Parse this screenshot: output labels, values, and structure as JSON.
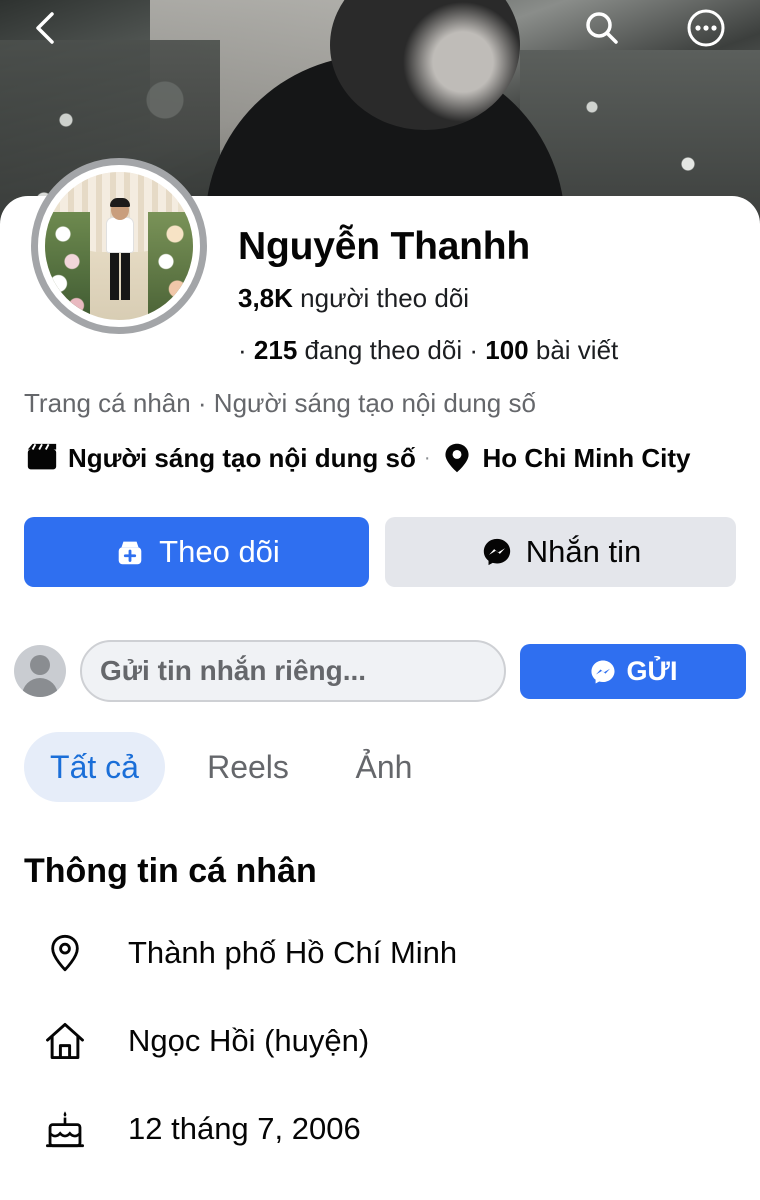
{
  "profile": {
    "name": "Nguyễn Thanhh",
    "followers_count": "3,8K",
    "followers_label": "người theo dõi",
    "following_count": "215",
    "following_label": "đang theo dõi",
    "posts_count": "100",
    "posts_label": "bài viết",
    "subtitle": "Trang cá nhân · Người sáng tạo nội dung số",
    "category": "Người sáng tạo nội dung số",
    "location": "Ho Chi Minh City"
  },
  "actions": {
    "follow_label": "Theo dõi",
    "message_label": "Nhắn tin"
  },
  "private_message": {
    "placeholder": "Gửi tin nhắn riêng...",
    "send_label": "GỬI"
  },
  "tabs": [
    {
      "label": "Tất cả",
      "active": true
    },
    {
      "label": "Reels",
      "active": false
    },
    {
      "label": "Ảnh",
      "active": false
    }
  ],
  "about": {
    "title": "Thông tin cá nhân",
    "items": [
      {
        "icon": "location-pin-icon",
        "text": "Thành phố Hồ Chí Minh"
      },
      {
        "icon": "home-icon",
        "text": "Ngọc Hồi (huyện)"
      },
      {
        "icon": "birthday-cake-icon",
        "text": "12 tháng 7, 2006"
      }
    ]
  },
  "colors": {
    "primary": "#2f6ff0",
    "secondary_button": "#e4e6eb",
    "active_tab_bg": "#e6edf9",
    "active_tab_text": "#1a6ed8",
    "muted_text": "#65676b"
  }
}
